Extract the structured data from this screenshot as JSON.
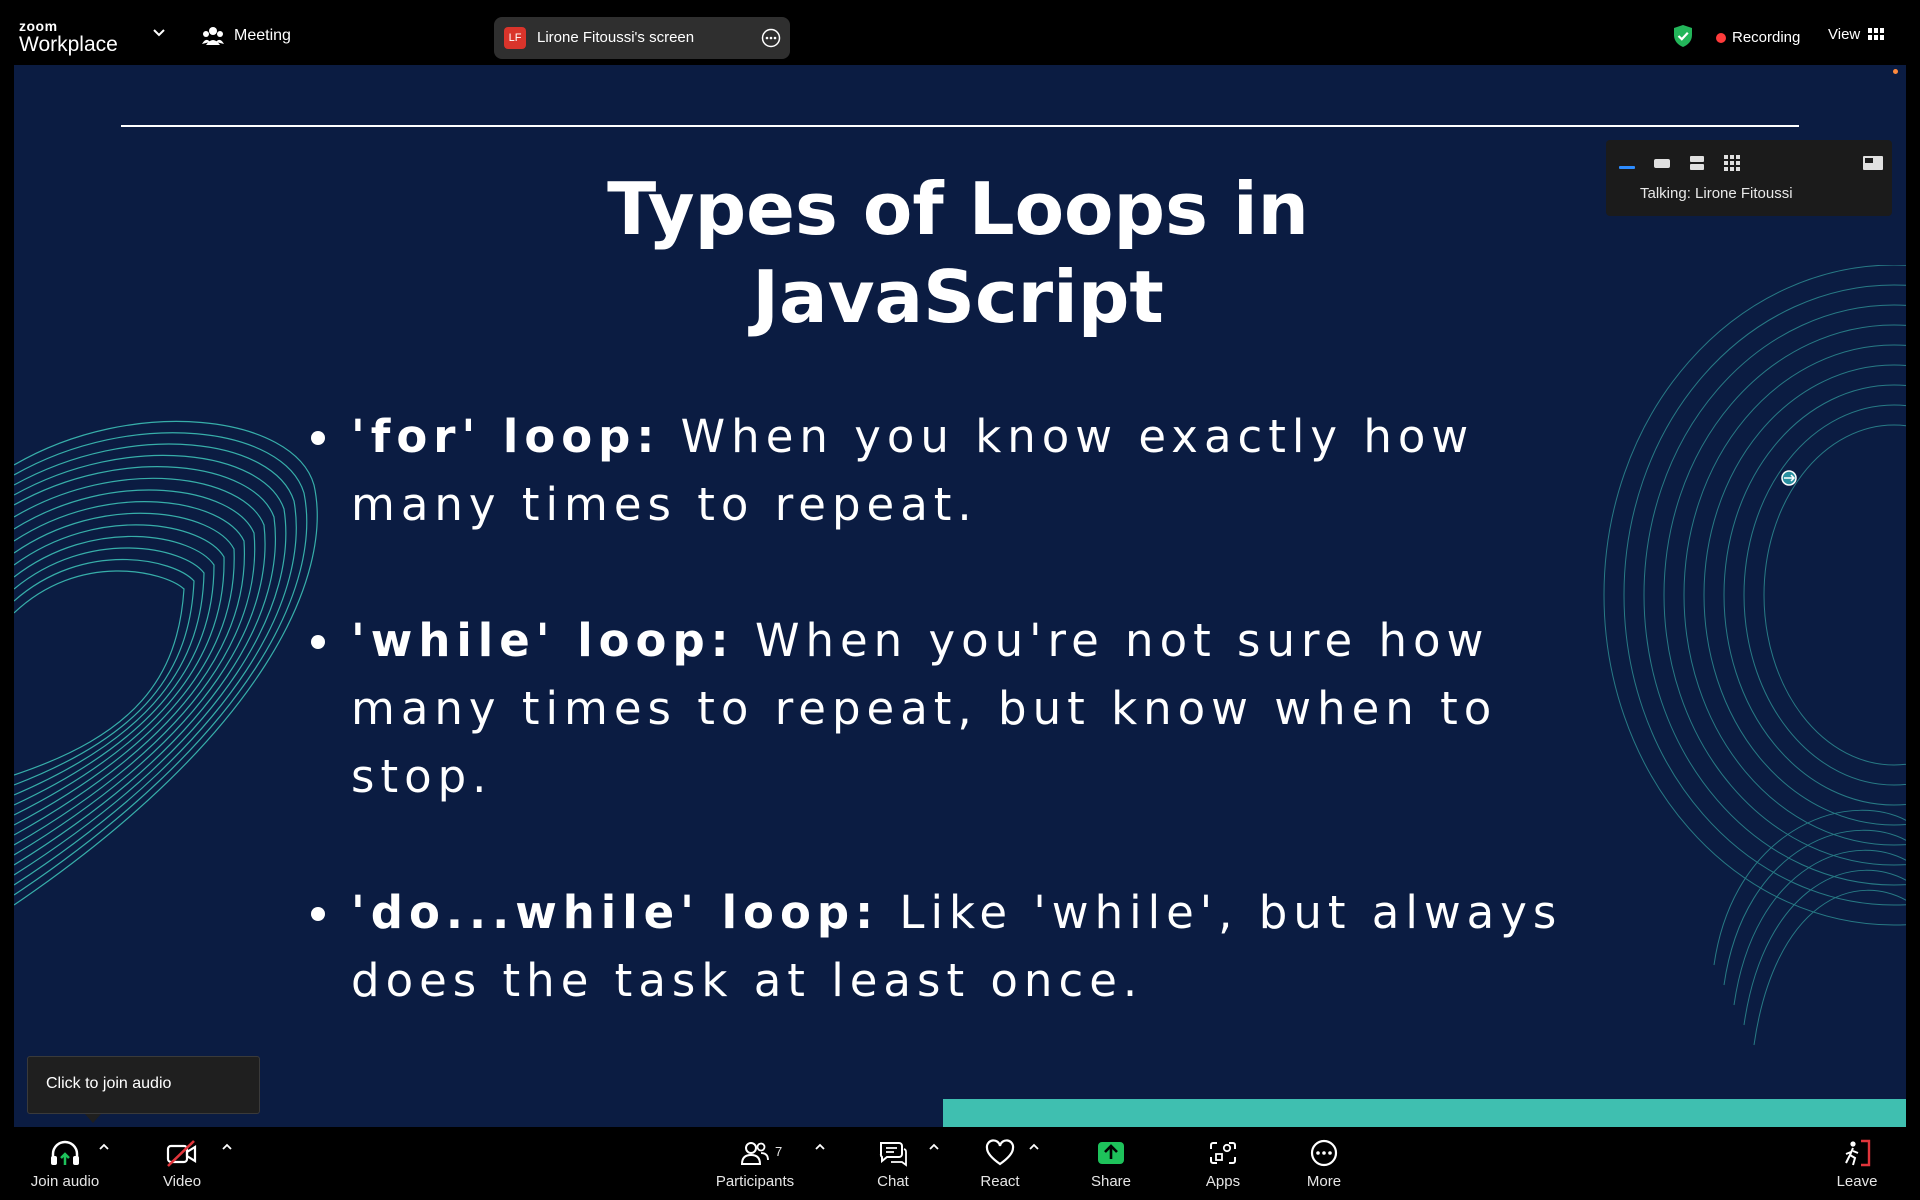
{
  "app": {
    "logo_top": "zoom",
    "logo_bottom": "Workplace",
    "meeting_label": "Meeting",
    "screen_share": {
      "initials": "LF",
      "label": "Lirone Fitoussi's screen"
    },
    "recording_label": "Recording",
    "view_label": "View"
  },
  "slide": {
    "title_line1": "Types of Loops in",
    "title_line2": "JavaScript",
    "bullets": [
      {
        "term": "'for' loop:",
        "text": " When you know exactly how many times to repeat."
      },
      {
        "term": "'while' loop:",
        "text": " When you're not sure how many times to repeat, but know when to stop."
      },
      {
        "term": "'do...while' loop:",
        "text": " Like 'while', but always does the task at least once."
      }
    ]
  },
  "talking_panel": {
    "text": "Talking: Lirone Fitoussi"
  },
  "tooltip": {
    "text": "Click to join audio"
  },
  "toolbar": {
    "join_audio": "Join audio",
    "video": "Video",
    "participants": "Participants",
    "participants_count": "7",
    "chat": "Chat",
    "react": "React",
    "share": "Share",
    "apps": "Apps",
    "more": "More",
    "leave": "Leave"
  },
  "colors": {
    "slide_bg": "#0b1c42",
    "accent_teal": "#3fbfb0",
    "share_green": "#1ec25b",
    "recording_red": "#ff3b3b",
    "leave_red": "#e0353b"
  }
}
